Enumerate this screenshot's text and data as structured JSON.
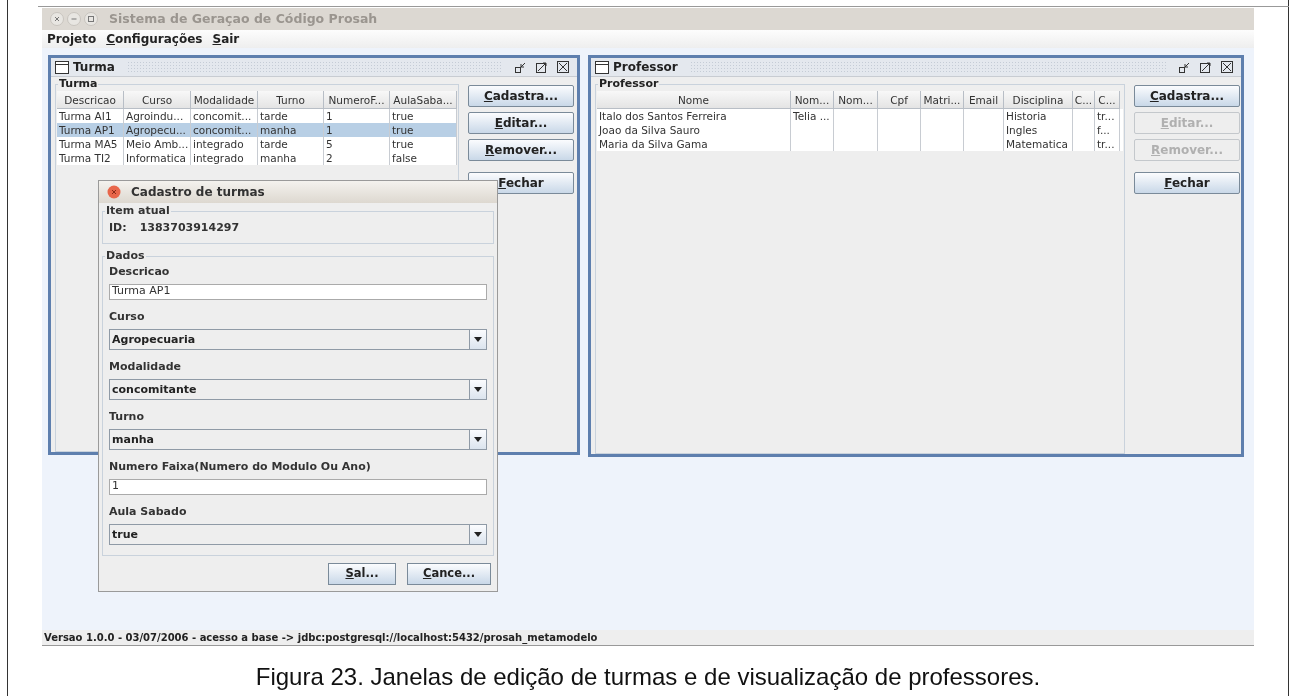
{
  "window": {
    "title": "Sistema de Geraçao de Código Prosah"
  },
  "menu": [
    {
      "label": "Projeto",
      "mnemonic": false
    },
    {
      "label": "Configurações",
      "mnemonic": true
    },
    {
      "label": "Sair",
      "mnemonic": true
    }
  ],
  "turma_frame": {
    "title": "Turma",
    "group": "Turma",
    "columns": [
      "Descricao",
      "Curso",
      "Modalidade",
      "Turno",
      "NumeroF...",
      "AulaSaba..."
    ],
    "rows": [
      {
        "cells": [
          "Turma AI1",
          "Agroindu...",
          "concomit...",
          "tarde",
          "1",
          "true"
        ],
        "selected": false
      },
      {
        "cells": [
          "Turma AP1",
          "Agropecu...",
          "concomit...",
          "manha",
          "1",
          "true"
        ],
        "selected": true
      },
      {
        "cells": [
          "Turma MA5",
          "Meio Amb...",
          "integrado",
          "tarde",
          "5",
          "true"
        ],
        "selected": false
      },
      {
        "cells": [
          "Turma TI2",
          "Informatica",
          "integrado",
          "manha",
          "2",
          "false"
        ],
        "selected": false
      }
    ],
    "buttons": [
      {
        "label": "Cadastra...",
        "mnemonic": true,
        "disabled": false
      },
      {
        "label": "Editar...",
        "mnemonic": true,
        "disabled": false
      },
      {
        "label": "Remover...",
        "mnemonic": true,
        "disabled": false
      },
      {
        "label": "Fechar",
        "mnemonic": true,
        "disabled": false
      }
    ]
  },
  "professor_frame": {
    "title": "Professor",
    "group": "Professor",
    "columns": [
      "Nome",
      "Nom...",
      "Nom...",
      "Cpf",
      "Matri...",
      "Email",
      "Disciplina",
      "C...",
      "C..."
    ],
    "rows": [
      {
        "cells": [
          "Italo dos Santos Ferreira",
          "Telia ...",
          null,
          null,
          null,
          null,
          "Historia",
          null,
          "tr..."
        ],
        "selected": false
      },
      {
        "cells": [
          "Joao da Silva Sauro",
          null,
          null,
          null,
          null,
          null,
          "Ingles",
          null,
          "f..."
        ],
        "selected": false
      },
      {
        "cells": [
          "Maria da Silva Gama",
          null,
          null,
          null,
          null,
          null,
          "Matematica",
          null,
          "tr..."
        ],
        "selected": false
      }
    ],
    "buttons": [
      {
        "label": "Cadastra...",
        "mnemonic": true,
        "disabled": false
      },
      {
        "label": "Editar...",
        "mnemonic": true,
        "disabled": true
      },
      {
        "label": "Remover...",
        "mnemonic": true,
        "disabled": true
      },
      {
        "label": "Fechar",
        "mnemonic": true,
        "disabled": false
      }
    ]
  },
  "dialog": {
    "title": "Cadastro de turmas",
    "item_group": "Item atual",
    "id_label": "ID:",
    "id_value": "1383703914297",
    "data_group": "Dados",
    "fields": [
      {
        "kind": "text",
        "label": "Descricao",
        "value": "Turma AP1"
      },
      {
        "kind": "combo",
        "label": "Curso",
        "value": "Agropecuaria"
      },
      {
        "kind": "combo",
        "label": "Modalidade",
        "value": "concomitante"
      },
      {
        "kind": "combo",
        "label": "Turno",
        "value": "manha"
      },
      {
        "kind": "text",
        "label": "Numero Faixa(Numero do Modulo Ou Ano)",
        "value": "1"
      },
      {
        "kind": "combo",
        "label": "Aula Sabado",
        "value": "true"
      }
    ],
    "buttons": [
      {
        "label": "Sal...",
        "mnemonic": true,
        "disabled": false
      },
      {
        "label": "Cance...",
        "mnemonic": true,
        "disabled": false
      }
    ]
  },
  "status_bar": "Versao 1.0.0 - 03/07/2006 - acesso a base -> jdbc:postgresql://localhost:5432/prosah_metamodelo",
  "caption": "Figura 23. Janelas de edição de turmas e de visualização de professores."
}
